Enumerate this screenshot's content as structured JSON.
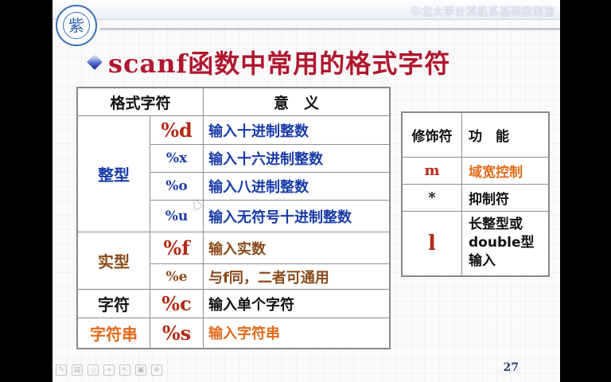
{
  "header": {
    "dept": "中北大学计算机系基础教研室",
    "logo_char": "紫"
  },
  "title": "scanf函数中常用的格式字符",
  "main_table": {
    "headers": [
      "格式字符",
      "意　义"
    ],
    "rows": [
      {
        "category": "整型",
        "code": "%d",
        "meaning": "输入十进制",
        "meaning_suffix": "整数"
      },
      {
        "code": "%x",
        "meaning": "输入十六进制",
        "meaning_suffix": "整数"
      },
      {
        "code": "%o",
        "meaning": "输入八进制",
        "meaning_suffix": "整数"
      },
      {
        "code": "%u",
        "meaning": "输入无符号十进制",
        "meaning_suffix": "整数"
      },
      {
        "category": "实型",
        "code": "%f",
        "meaning": "输入实数"
      },
      {
        "code": "%e",
        "meaning": "与f同，二者可通用"
      },
      {
        "category": "字符",
        "code": "%c",
        "meaning": "输入单个字符"
      },
      {
        "category": "字符串",
        "code": "%s",
        "meaning": "输入字符串"
      }
    ]
  },
  "side_table": {
    "headers": [
      "修饰符",
      "功　能"
    ],
    "rows": [
      {
        "modifier": "m",
        "function": "域宽控制"
      },
      {
        "modifier": "*",
        "function": "抑制符"
      },
      {
        "modifier": "l",
        "function": "长整型或double型输入"
      }
    ]
  },
  "page_number": "27",
  "colors": {
    "title": "#b0172e",
    "blue_text": "#1a3ca8",
    "red_code": "#b32a16",
    "orange": "#e26a1a"
  },
  "toolbar_icons": [
    "pen-icon",
    "slide-icon",
    "eraser-icon",
    "link-icon",
    "pointer-icon",
    "window-icon",
    "zoom-icon"
  ]
}
